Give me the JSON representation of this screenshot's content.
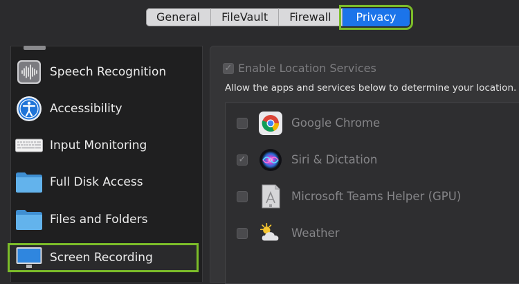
{
  "tabs": [
    {
      "label": "General"
    },
    {
      "label": "FileVault"
    },
    {
      "label": "Firewall"
    },
    {
      "label": "Privacy",
      "active": true
    }
  ],
  "sidebar": {
    "items": [
      {
        "label": "Speech Recognition",
        "icon": "waveform-icon"
      },
      {
        "label": "Accessibility",
        "icon": "accessibility-icon"
      },
      {
        "label": "Input Monitoring",
        "icon": "keyboard-icon"
      },
      {
        "label": "Full Disk Access",
        "icon": "folder-icon"
      },
      {
        "label": "Files and Folders",
        "icon": "folder-icon"
      },
      {
        "label": "Screen Recording",
        "icon": "display-icon",
        "selected": true
      }
    ]
  },
  "location": {
    "enable_label": "Enable Location Services",
    "enabled": true,
    "description": "Allow the apps and services below to determine your location."
  },
  "apps": [
    {
      "name": "Google Chrome",
      "checked": false,
      "icon": "chrome-icon"
    },
    {
      "name": "Siri & Dictation",
      "checked": true,
      "icon": "siri-icon"
    },
    {
      "name": "Microsoft Teams Helper (GPU)",
      "checked": false,
      "icon": "app-generic-icon"
    },
    {
      "name": "Weather",
      "checked": false,
      "icon": "weather-icon"
    }
  ],
  "colors": {
    "accent": "#1b74ea",
    "highlight": "#7cbd29",
    "background": "#2b2b2d"
  }
}
